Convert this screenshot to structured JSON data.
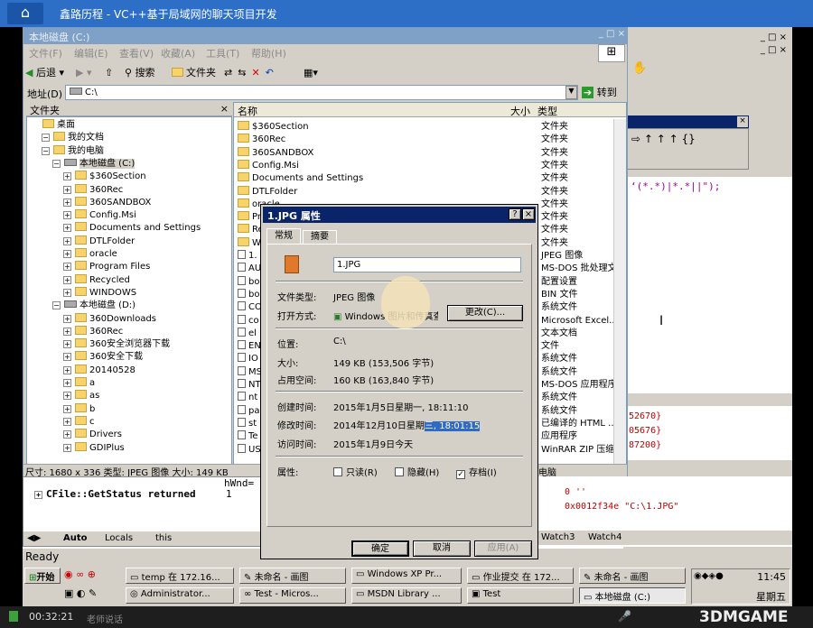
{
  "player": {
    "title": "鑫路历程 - VC++基于局域网的聊天项目开发",
    "time": "00:32:21",
    "speaker_label": "老师说话",
    "watermark": "3DMGAME"
  },
  "explorer": {
    "title": "本地磁盘 (C:)",
    "menu": [
      "文件(F)",
      "编辑(E)",
      "查看(V)",
      "收藏(A)",
      "工具(T)",
      "帮助(H)"
    ],
    "toolbar": {
      "back": "后退",
      "search": "搜索",
      "folders": "文件夹"
    },
    "address_label": "地址(D)",
    "address_value": "C:\\",
    "go_label": "转到",
    "tree_header": "文件夹",
    "tree": [
      {
        "label": "桌面",
        "indent": 0
      },
      {
        "label": "我的文档",
        "indent": 1
      },
      {
        "label": "我的电脑",
        "indent": 1
      },
      {
        "label": "本地磁盘 (C:)",
        "indent": 2
      },
      {
        "label": "$360Section",
        "indent": 3
      },
      {
        "label": "360Rec",
        "indent": 3
      },
      {
        "label": "360SANDBOX",
        "indent": 3
      },
      {
        "label": "Config.Msi",
        "indent": 3
      },
      {
        "label": "Documents and Settings",
        "indent": 3
      },
      {
        "label": "DTLFolder",
        "indent": 3
      },
      {
        "label": "oracle",
        "indent": 3
      },
      {
        "label": "Program Files",
        "indent": 3
      },
      {
        "label": "Recycled",
        "indent": 3
      },
      {
        "label": "WINDOWS",
        "indent": 3
      },
      {
        "label": "本地磁盘 (D:)",
        "indent": 2
      },
      {
        "label": "360Downloads",
        "indent": 3
      },
      {
        "label": "360Rec",
        "indent": 3
      },
      {
        "label": "360安全浏览器下载",
        "indent": 3
      },
      {
        "label": "360安全下载",
        "indent": 3
      },
      {
        "label": "20140528",
        "indent": 3
      },
      {
        "label": "a",
        "indent": 3
      },
      {
        "label": "as",
        "indent": 3
      },
      {
        "label": "b",
        "indent": 3
      },
      {
        "label": "c",
        "indent": 3
      },
      {
        "label": "Drivers",
        "indent": 3
      },
      {
        "label": "GDIPlus",
        "indent": 3
      }
    ],
    "columns": {
      "name": "名称",
      "size": "大小",
      "type": "类型"
    },
    "files": [
      {
        "name": "$360Section",
        "type": "文件夹"
      },
      {
        "name": "360Rec",
        "type": "文件夹"
      },
      {
        "name": "360SANDBOX",
        "type": "文件夹"
      },
      {
        "name": "Config.Msi",
        "type": "文件夹"
      },
      {
        "name": "Documents and Settings",
        "type": "文件夹"
      },
      {
        "name": "DTLFolder",
        "type": "文件夹"
      },
      {
        "name": "oracle",
        "type": "文件夹"
      },
      {
        "name": "Pr",
        "type": "文件夹"
      },
      {
        "name": "Re",
        "type": "文件夹"
      },
      {
        "name": "WI",
        "type": "文件夹"
      },
      {
        "name": "1.",
        "type": "JPEG 图像"
      },
      {
        "name": "AU",
        "type": "MS-DOS 批处理文件"
      },
      {
        "name": "bo",
        "type": "配置设置"
      },
      {
        "name": "bo",
        "type": "BIN 文件"
      },
      {
        "name": "CO",
        "type": "系统文件"
      },
      {
        "name": "co",
        "type": "Microsoft Excel..."
      },
      {
        "name": "el",
        "type": "文本文档"
      },
      {
        "name": "EN",
        "type": "文件"
      },
      {
        "name": "IO",
        "type": "系统文件"
      },
      {
        "name": "MS",
        "type": "系统文件"
      },
      {
        "name": "NT",
        "type": "MS-DOS 应用程序"
      },
      {
        "name": "nt",
        "type": "系统文件"
      },
      {
        "name": "pa",
        "type": "系统文件"
      },
      {
        "name": "st",
        "type": "已编译的 HTML ..."
      },
      {
        "name": "Te",
        "type": "应用程序"
      },
      {
        "name": "US",
        "type": "WinRAR ZIP 压缩..."
      }
    ],
    "status": "尺寸: 1680 x 336 类型: JPEG 图像 大小: 149 KB",
    "status_right": "电脑"
  },
  "dialog": {
    "title": "1.JPG 属性",
    "tabs": [
      "常规",
      "摘要"
    ],
    "filename": "1.JPG",
    "type_label": "文件类型:",
    "type_value": "JPEG 图像",
    "open_label": "打开方式:",
    "open_value": "Windows 图片和传真查看器",
    "change_btn": "更改(C)...",
    "location_label": "位置:",
    "location_value": "C:\\",
    "size_label": "大小:",
    "size_value": "149 KB (153,506 字节)",
    "disk_label": "占用空间:",
    "disk_value": "160 KB (163,840 字节)",
    "created_label": "创建时间:",
    "created_value": "2015年1月5日星期一, 18:11:10",
    "modified_label": "修改时间:",
    "modified_value_a": "2014年12月10日星期",
    "modified_value_b": "三, 18:01:15",
    "accessed_label": "访问时间:",
    "accessed_value": "2015年1月9日今天",
    "attr_label": "属性:",
    "attr_readonly": "只读(R)",
    "attr_hidden": "隐藏(H)",
    "attr_archive": "存档(I)",
    "ok": "确定",
    "cancel": "取消",
    "apply": "应用(A)"
  },
  "vc": {
    "code_line": "‘(*.*)|*.*||\");",
    "debug_left_line": "CFile::GetStatus returned",
    "debug_left_val": "1",
    "debug_top": "hWnd=",
    "tabs_left": [
      "Auto",
      "Locals",
      "this"
    ],
    "tabs_right": [
      "Watch3",
      "Watch4"
    ],
    "watch_lines": [
      {
        "text": "52670}",
        "color": "#c00000"
      },
      {
        "text": "05676}",
        "color": "#c00000"
      },
      {
        "text": "87200}",
        "color": "#c00000"
      },
      {
        "text": "0 ''",
        "color": "#c00000"
      },
      {
        "text": "0x0012f34e \"C:\\1.JPG\"",
        "color": "#c00000"
      }
    ],
    "ready": "Ready"
  },
  "taskbar": {
    "start": "开始",
    "row1": [
      "temp 在 172.16...",
      "未命名 - 画图",
      "Windows XP Pr...",
      "作业提交 在 172...",
      "未命名 - 画图"
    ],
    "row2": [
      "Administrator...",
      "Test - Micros...",
      "MSDN Library ...",
      "Test",
      "本地磁盘 (C:)"
    ],
    "clock": "11:45",
    "day": "星期五"
  }
}
